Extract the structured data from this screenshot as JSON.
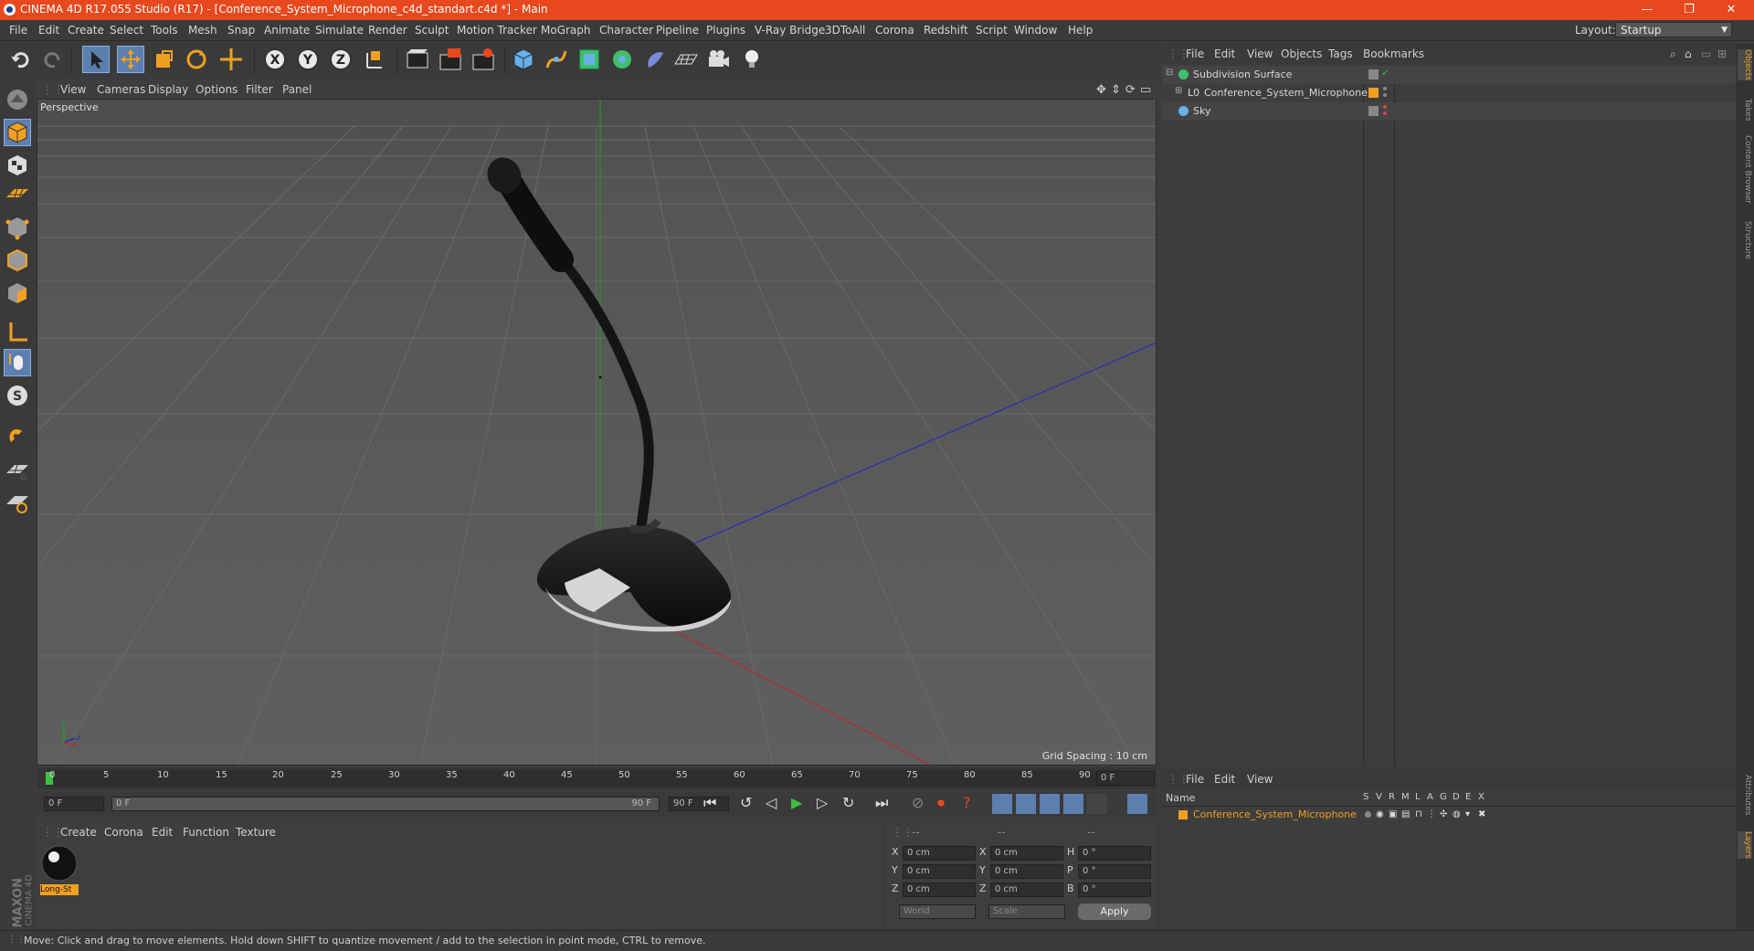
{
  "window": {
    "title": "CINEMA 4D R17.055 Studio (R17) - [Conference_System_Microphone_c4d_standart.c4d *] - Main",
    "minimize": "—",
    "restore": "❐",
    "close": "✕"
  },
  "menubar": {
    "items": [
      "File",
      "Edit",
      "Create",
      "Select",
      "Tools",
      "Mesh",
      "Snap",
      "Animate",
      "Simulate",
      "Render",
      "Sculpt",
      "Motion Tracker",
      "MoGraph",
      "Character",
      "Pipeline",
      "Plugins",
      "V-Ray Bridge",
      "3DToAll",
      "Corona",
      "Redshift",
      "Script",
      "Window",
      "Help"
    ],
    "layout_label": "Layout:",
    "layout_value": "Startup"
  },
  "viewport": {
    "menu": [
      "View",
      "Cameras",
      "Display",
      "Options",
      "Filter",
      "Panel"
    ],
    "label": "Perspective",
    "grid_spacing": "Grid Spacing : 10 cm",
    "axis_labels": {
      "y": "y",
      "z": "z"
    }
  },
  "timeline": {
    "ticks": [
      "0",
      "5",
      "10",
      "15",
      "20",
      "25",
      "30",
      "35",
      "40",
      "45",
      "50",
      "55",
      "60",
      "65",
      "70",
      "75",
      "80",
      "85",
      "90"
    ],
    "current_frame": "0 F",
    "start_field": "0 F",
    "range_start": "0 F",
    "range_end": "90 F",
    "end_field": "90 F"
  },
  "materials": {
    "menu": [
      "Create",
      "Corona",
      "Edit",
      "Function",
      "Texture"
    ],
    "swatch_label": "Long-St",
    "brand": "MAXON",
    "brand_product": "CINEMA 4D"
  },
  "coordinates": {
    "header": [
      "--",
      "--",
      "--"
    ],
    "rows": [
      {
        "a": "X",
        "av": "0 cm",
        "b": "X",
        "bv": "0 cm",
        "c": "H",
        "cv": "0 °"
      },
      {
        "a": "Y",
        "av": "0 cm",
        "b": "Y",
        "bv": "0 cm",
        "c": "P",
        "cv": "0 °"
      },
      {
        "a": "Z",
        "av": "0 cm",
        "b": "Z",
        "bv": "0 cm",
        "c": "B",
        "cv": "0 °"
      }
    ],
    "space": "World",
    "mode": "Scale",
    "apply": "Apply"
  },
  "objects": {
    "menu": [
      "File",
      "Edit",
      "View",
      "Objects",
      "Tags",
      "Bookmarks"
    ],
    "items": [
      {
        "name": "Subdivision Surface"
      },
      {
        "name": "Conference_System_Microphone"
      },
      {
        "name": "Sky"
      }
    ]
  },
  "layers": {
    "menu": [
      "File",
      "Edit",
      "View"
    ],
    "col_name": "Name",
    "cols": [
      "S",
      "V",
      "R",
      "M",
      "L",
      "A",
      "G",
      "D",
      "E",
      "X"
    ],
    "row_name": "Conference_System_Microphone"
  },
  "right_tabs": [
    "Objects",
    "Takes",
    "Content Browser",
    "Structure",
    "Attributes",
    "Layers"
  ],
  "status": {
    "text": "Move: Click and drag to move elements. Hold down SHIFT to quantize movement / add to the selection in point mode, CTRL to remove."
  },
  "colors": {
    "title_bar": "#e8481d",
    "accent_select": "#5b7fae",
    "layer_orange": "#f0a020"
  }
}
